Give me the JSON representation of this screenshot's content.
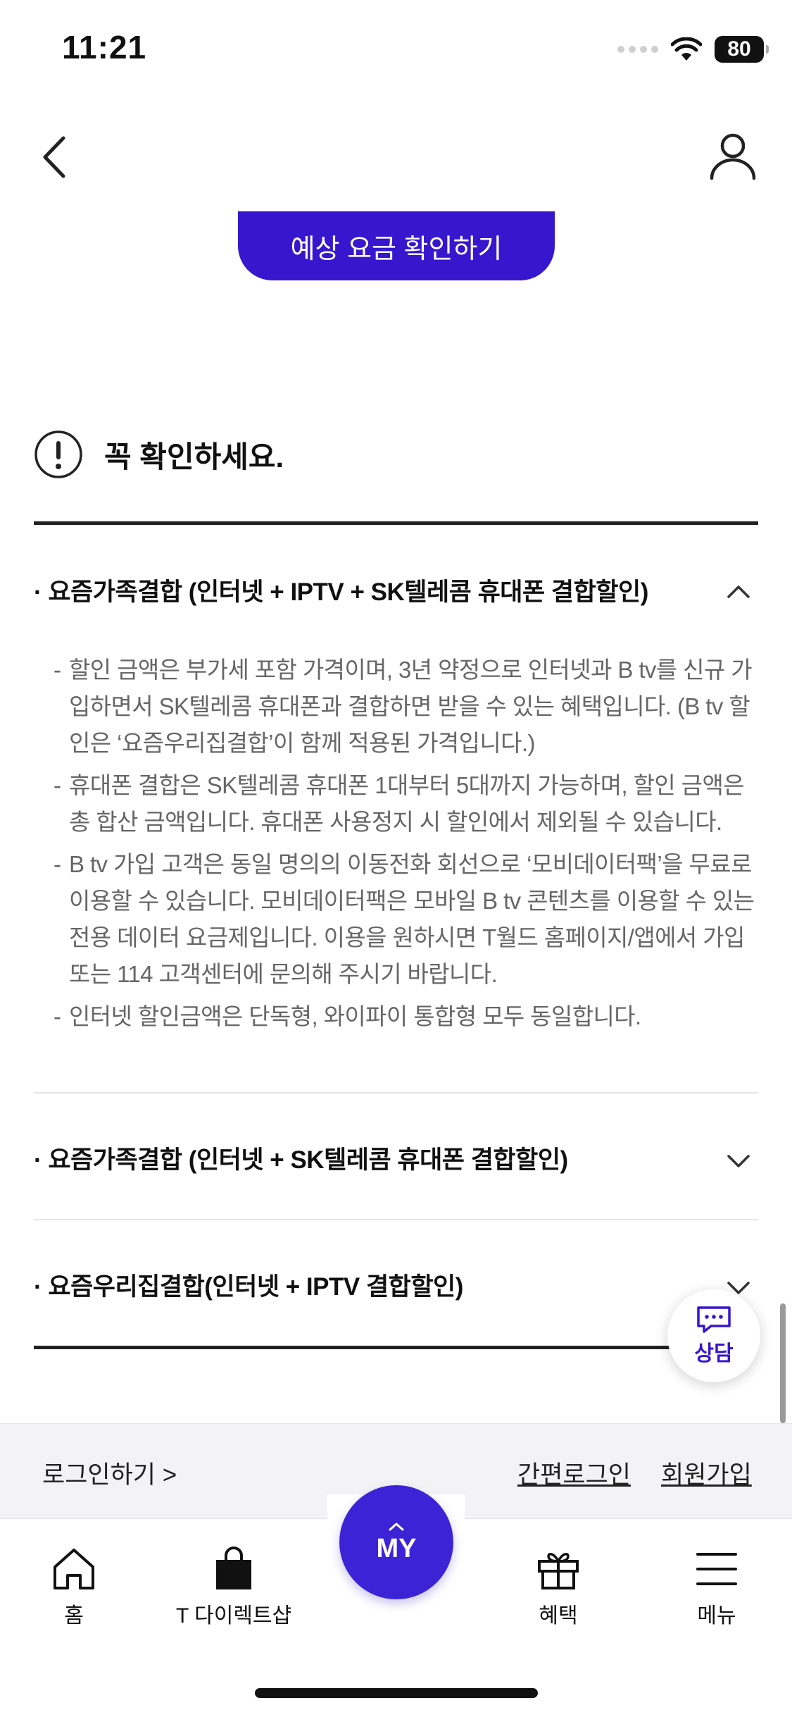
{
  "status": {
    "time": "11:21",
    "battery": "80"
  },
  "cta": {
    "label": "예상 요금 확인하기"
  },
  "notice": {
    "title": "꼭 확인하세요."
  },
  "accordion": [
    {
      "title": "· 요즘가족결합 (인터넷 + IPTV + SK텔레콤 휴대폰 결합할인)",
      "expanded": true,
      "bullets": [
        "할인 금액은 부가세 포함 가격이며, 3년 약정으로 인터넷과 B tv를 신규 가입하면서 SK텔레콤 휴대폰과 결합하면 받을 수 있는 혜택입니다. (B tv 할인은 ‘요즘우리집결합’이 함께 적용된 가격입니다.)",
        "휴대폰 결합은 SK텔레콤 휴대폰 1대부터 5대까지 가능하며, 할인 금액은 총 합산 금액입니다. 휴대폰 사용정지 시 할인에서 제외될 수 있습니다.",
        "B tv 가입 고객은 동일 명의의 이동전화 회선으로 ‘모비데이터팩’을 무료로 이용할 수 있습니다. 모비데이터팩은 모바일 B tv 콘텐츠를 이용할 수 있는 전용 데이터 요금제입니다. 이용을 원하시면 T월드 홈페이지/앱에서 가입 또는 114 고객센터에 문의해 주시기 바랍니다.",
        "인터넷 할인금액은 단독형, 와이파이 통합형 모두 동일합니다."
      ]
    },
    {
      "title": "· 요즘가족결합 (인터넷 + SK텔레콤 휴대폰 결합할인)",
      "expanded": false
    },
    {
      "title": "· 요즘우리집결합(인터넷 + IPTV 결합할인)",
      "expanded": false
    }
  ],
  "chat": {
    "label": "상담"
  },
  "login_bar": {
    "login": "로그인하기 >",
    "quick_login": "간편로그인",
    "signup": "회원가입"
  },
  "tabs": {
    "home": "홈",
    "shop": "T 다이렉트샵",
    "my": "MY",
    "benefits": "혜택",
    "menu": "메뉴"
  },
  "colors": {
    "brand": "#3617ce"
  }
}
